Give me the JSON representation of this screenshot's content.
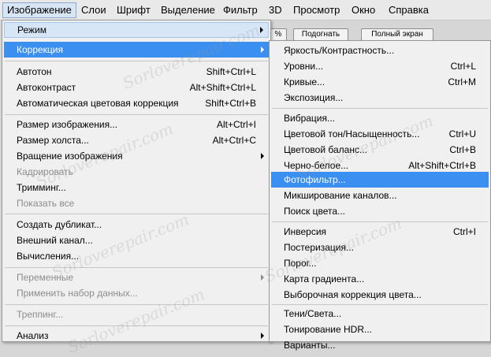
{
  "menubar": {
    "items": [
      "Изображение",
      "Слои",
      "Шрифт",
      "Выделение",
      "Фильтр",
      "3D",
      "Просмотр",
      "Окно",
      "Справка"
    ]
  },
  "toolbar": {
    "btn_partial": "%",
    "fit_label": "Подогнать",
    "fullscreen_label": "Полный экран"
  },
  "image_menu": {
    "mode": "Режим",
    "adjustments": "Коррекция",
    "autotone": {
      "label": "Автотон",
      "shortcut": "Shift+Ctrl+L"
    },
    "autocontrast": {
      "label": "Автоконтраст",
      "shortcut": "Alt+Shift+Ctrl+L"
    },
    "autocolor": {
      "label": "Автоматическая цветовая коррекция",
      "shortcut": "Shift+Ctrl+B"
    },
    "image_size": {
      "label": "Размер изображения...",
      "shortcut": "Alt+Ctrl+I"
    },
    "canvas_size": {
      "label": "Размер холста...",
      "shortcut": "Alt+Ctrl+C"
    },
    "rotation": "Вращение изображения",
    "crop": "Кадрировать",
    "trim": "Тримминг...",
    "reveal_all": "Показать все",
    "duplicate": "Создать дубликат...",
    "apply_image": "Внешний канал...",
    "calculations": "Вычисления...",
    "variables": "Переменные",
    "apply_data_set": "Применить набор данных...",
    "trap": "Треппинг...",
    "analysis": "Анализ"
  },
  "adjust_menu": {
    "brightness": {
      "label": "Яркость/Контрастность...",
      "shortcut": ""
    },
    "levels": {
      "label": "Уровни...",
      "shortcut": "Ctrl+L"
    },
    "curves": {
      "label": "Кривые...",
      "shortcut": "Ctrl+M"
    },
    "exposure": {
      "label": "Экспозиция...",
      "shortcut": ""
    },
    "vibrance": {
      "label": "Вибрация...",
      "shortcut": ""
    },
    "hue_sat": {
      "label": "Цветовой тон/Насыщенность...",
      "shortcut": "Ctrl+U"
    },
    "color_balance": {
      "label": "Цветовой баланс...",
      "shortcut": "Ctrl+B"
    },
    "black_white": {
      "label": "Черно-белое...",
      "shortcut": "Alt+Shift+Ctrl+B"
    },
    "photo_filter": {
      "label": "Фотофильтр...",
      "shortcut": ""
    },
    "channel_mixer": {
      "label": "Микширование каналов...",
      "shortcut": ""
    },
    "color_lookup": {
      "label": "Поиск цвета...",
      "shortcut": ""
    },
    "invert": {
      "label": "Инверсия",
      "shortcut": "Ctrl+I"
    },
    "posterize": {
      "label": "Постеризация...",
      "shortcut": ""
    },
    "threshold": {
      "label": "Порог...",
      "shortcut": ""
    },
    "gradient_map": {
      "label": "Карта градиента...",
      "shortcut": ""
    },
    "selective_color": {
      "label": "Выборочная коррекция цвета...",
      "shortcut": ""
    },
    "shadows_highlights": {
      "label": "Тени/Света...",
      "shortcut": ""
    },
    "hdr_toning": {
      "label": "Тонирование HDR...",
      "shortcut": ""
    },
    "variations": {
      "label": "Варианты...",
      "shortcut": ""
    }
  },
  "watermark": "Sorloverepair.com",
  "colors": {
    "highlight": "#3b8ff0",
    "menu_bg": "#f0f0f0",
    "disabled_text": "#8c8c8c"
  }
}
